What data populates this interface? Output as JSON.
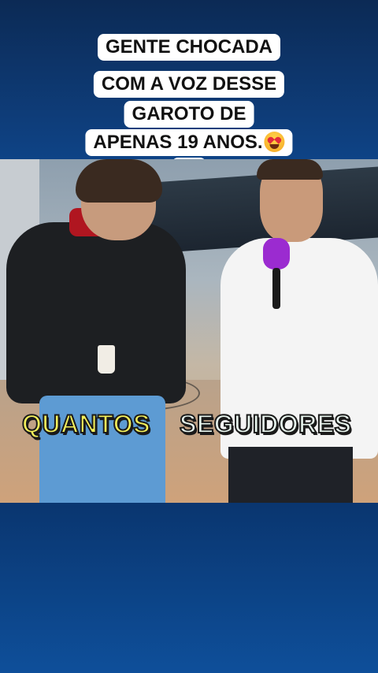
{
  "caption": {
    "lines": [
      "GENTE CHOCADA",
      "COM A VOZ DESSE",
      "GAROTO DE",
      "APENAS 19 ANOS."
    ],
    "emoji": "heart-eyes-emoji"
  },
  "video": {
    "subtitle_words": [
      "QUANTOS",
      "SEGUIDORES"
    ]
  },
  "colors": {
    "subtitle_yellow": "#f4f05a",
    "subtitle_white": "#e8f5ee",
    "background": "#0f4a93"
  }
}
